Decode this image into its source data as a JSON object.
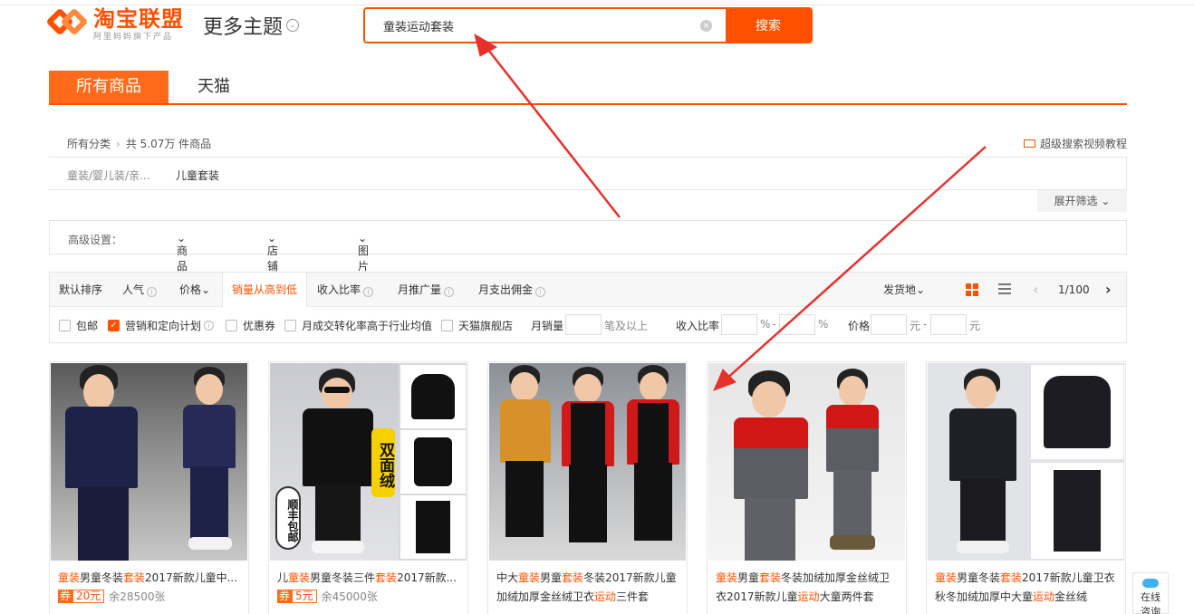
{
  "header": {
    "logo_title": "淘宝联盟",
    "logo_sub": "阿里妈妈旗下产品",
    "theme_label": "更多主题"
  },
  "search": {
    "value": "童装运动套装",
    "button": "搜索"
  },
  "tabs": [
    {
      "label": "所有商品"
    },
    {
      "label": "天猫"
    }
  ],
  "breadcrumb": {
    "root": "所有分类",
    "count": "共 5.07万 件商品"
  },
  "video_tutorial": "超级搜索视频教程",
  "categories": {
    "parent": "童装/婴儿装/亲...",
    "child": "儿童套装"
  },
  "expand_label": "展开筛选",
  "advanced": {
    "label": "高级设置：",
    "items": [
      "商品要求",
      "店铺要求",
      "图片要求"
    ]
  },
  "sort": {
    "items": [
      "默认排序",
      "人气",
      "价格",
      "销量从高到低",
      "收入比率",
      "月推广量",
      "月支出佣金"
    ],
    "ship_from": "发货地",
    "page": "1/100"
  },
  "filters": {
    "free_shipping": "包邮",
    "marketing_plan": "营销和定向计划",
    "coupon": "优惠券",
    "conversion": "月成交转化率高于行业均值",
    "tmall_flagship": "天猫旗舰店",
    "monthly_sales": "月销量",
    "sales_suffix": "笔及以上",
    "income_ratio": "收入比率",
    "percent1": "%",
    "dash1": "-",
    "percent2": "%",
    "price": "价格",
    "yuan1": "元",
    "dash2": "-",
    "yuan2": "元"
  },
  "products": [
    {
      "title_parts": [
        {
          "t": "童装",
          "hl": true
        },
        {
          "t": "男童冬装",
          "hl": false
        },
        {
          "t": "套装",
          "hl": true
        },
        {
          "t": "2017新款儿童中...",
          "hl": false
        }
      ],
      "coupon_tag": "券",
      "coupon_amount": "20元",
      "remaining": "余28500张"
    },
    {
      "title_parts": [
        {
          "t": "儿",
          "hl": false
        },
        {
          "t": "童装",
          "hl": true
        },
        {
          "t": "男童冬装三件",
          "hl": false
        },
        {
          "t": "套装",
          "hl": true
        },
        {
          "t": "2017新款...",
          "hl": false
        }
      ],
      "coupon_tag": "券",
      "coupon_amount": "5元",
      "remaining": "余45000张",
      "image_text_1": "双面绒",
      "image_text_2": "顺丰包邮"
    },
    {
      "title_parts": [
        {
          "t": "中大",
          "hl": false
        },
        {
          "t": "童装",
          "hl": true
        },
        {
          "t": "男童",
          "hl": false
        },
        {
          "t": "套装",
          "hl": true
        },
        {
          "t": "冬装2017新款儿童加绒加厚金丝绒卫衣",
          "hl": false
        },
        {
          "t": "运动",
          "hl": true
        },
        {
          "t": "三件套",
          "hl": false
        }
      ]
    },
    {
      "title_parts": [
        {
          "t": "童装",
          "hl": true
        },
        {
          "t": "男童",
          "hl": false
        },
        {
          "t": "套装",
          "hl": true
        },
        {
          "t": "冬装加绒加厚金丝绒卫衣2017新款儿童",
          "hl": false
        },
        {
          "t": "运动",
          "hl": true
        },
        {
          "t": "大童两件套",
          "hl": false
        }
      ]
    },
    {
      "title_parts": [
        {
          "t": "童装",
          "hl": true
        },
        {
          "t": "男童冬装",
          "hl": false
        },
        {
          "t": "套装",
          "hl": true
        },
        {
          "t": "2017新款儿童卫衣秋冬加绒加厚中大童",
          "hl": false
        },
        {
          "t": "运动",
          "hl": true
        },
        {
          "t": "金丝绒",
          "hl": false
        }
      ]
    }
  ],
  "chat": {
    "line1": "在线",
    "line2": "咨询"
  },
  "colors": {
    "accent": "#ff5000",
    "annotation_arrow": "#e8312b"
  }
}
